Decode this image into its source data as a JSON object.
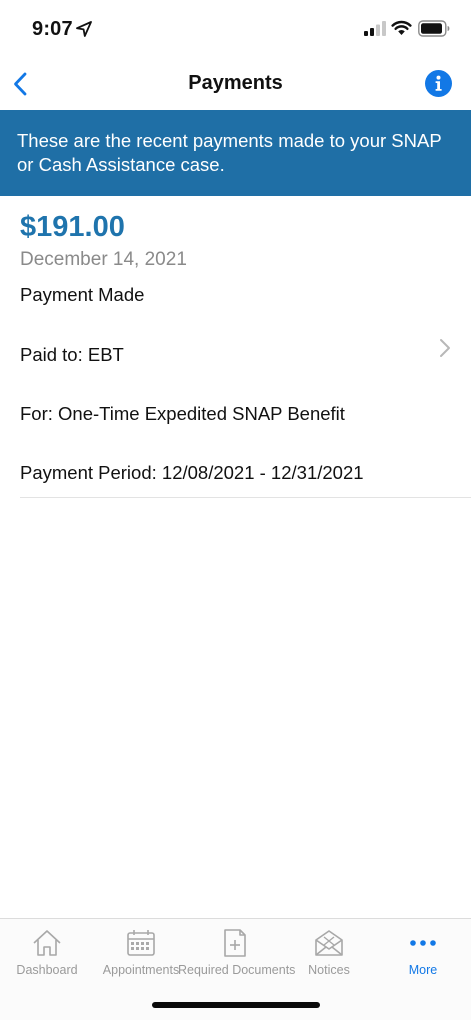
{
  "status_bar": {
    "time": "9:07"
  },
  "nav": {
    "title": "Payments"
  },
  "banner": {
    "text": "These are the recent payments made to your SNAP or Cash Assistance case."
  },
  "payment": {
    "amount": "$191.00",
    "date": "December 14, 2021",
    "status": "Payment Made",
    "paid_to": "Paid to: EBT",
    "for": "For: One-Time Expedited SNAP Benefit",
    "period": "Payment Period: 12/08/2021 - 12/31/2021"
  },
  "tabs": [
    {
      "label": "Dashboard",
      "icon": "home-icon",
      "active": false
    },
    {
      "label": "Appointments",
      "icon": "calendar-icon",
      "active": false
    },
    {
      "label": "Required Documents",
      "icon": "document-add-icon",
      "active": false
    },
    {
      "label": "Notices",
      "icon": "envelope-icon",
      "active": false
    },
    {
      "label": "More",
      "icon": "more-icon",
      "active": true
    }
  ],
  "colors": {
    "banner_bg": "#1f6fa6",
    "amount": "#1f74ad",
    "accent": "#1278e6",
    "inactive_tab": "#9a9a9a"
  }
}
